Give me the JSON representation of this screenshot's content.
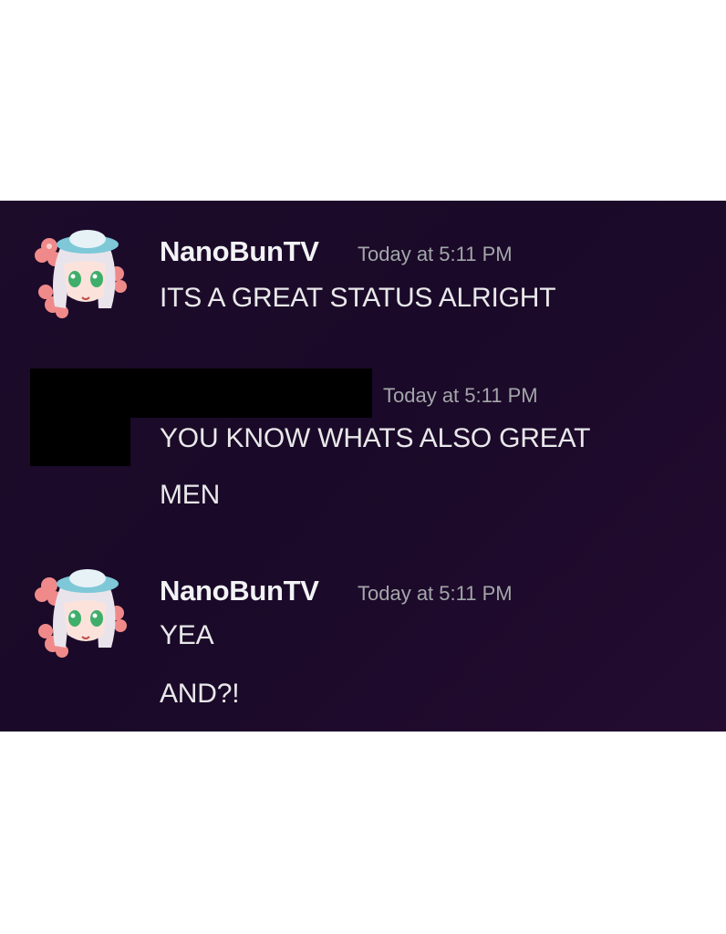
{
  "messages": [
    {
      "author": "NanoBunTV",
      "timestamp": "Today at 5:11 PM",
      "lines": [
        "ITS A GREAT STATUS ALRIGHT"
      ],
      "avatar_icon": "anime-avatar-icon",
      "name_color": "#f2f3f5"
    },
    {
      "author": "",
      "timestamp": "Today at 5:11 PM",
      "lines": [
        "YOU KNOW WHATS ALSO GREAT",
        "MEN"
      ],
      "redacted": true
    },
    {
      "author": "NanoBunTV",
      "timestamp": "Today at 5:11 PM",
      "lines": [
        "YEA",
        "AND?!"
      ],
      "avatar_icon": "anime-avatar-icon"
    }
  ],
  "colors": {
    "background": "#1d0b2a",
    "text": "#e8e8ea",
    "timestamp": "#a3a6aa",
    "redaction": "#000000"
  }
}
